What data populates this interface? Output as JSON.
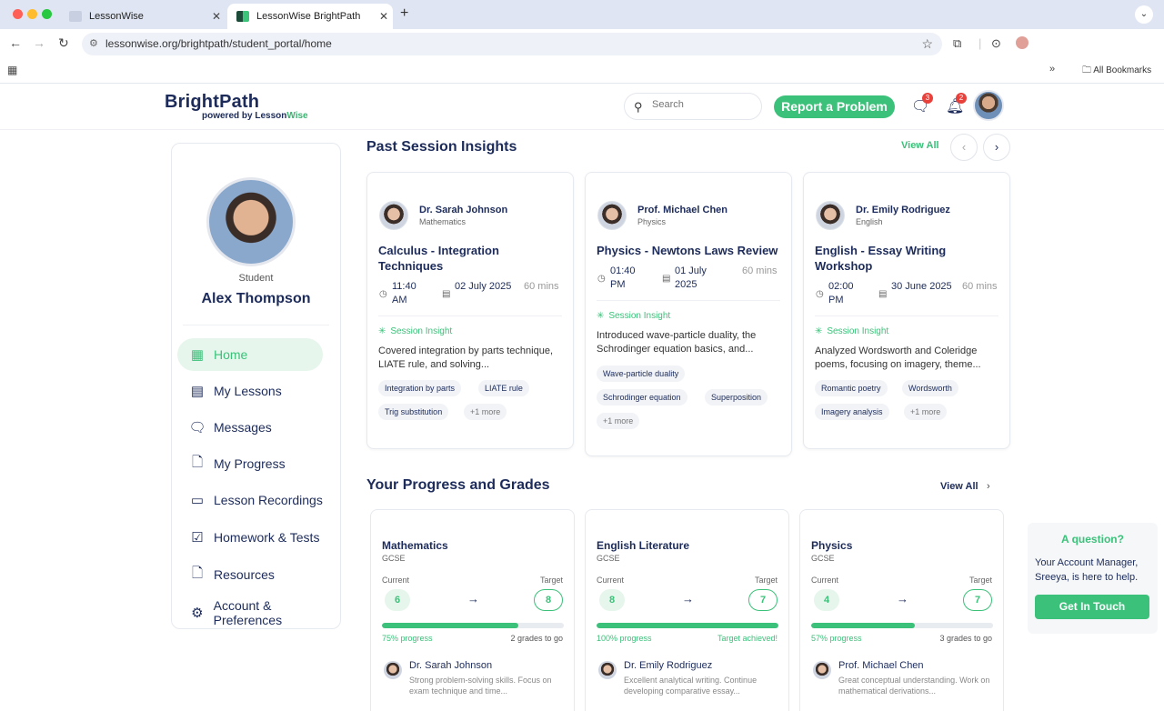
{
  "browser": {
    "tabs": [
      {
        "label": "LessonWise"
      },
      {
        "label": "LessonWise BrightPath"
      }
    ],
    "url": "lessonwise.org/brightpath/student_portal/home",
    "bookmarks_label": "All Bookmarks"
  },
  "header": {
    "logo_main": "BrightPath",
    "logo_sub_prefix": "powered by Lesson",
    "logo_sub_accent": "Wise",
    "search_placeholder": "Search",
    "report_label": "Report a Problem",
    "messages_count": "3",
    "notifications_count": "2"
  },
  "sidebar": {
    "role": "Student",
    "name": "Alex Thompson",
    "items": [
      {
        "label": "Home",
        "icon": "grid-icon"
      },
      {
        "label": "My Lessons",
        "icon": "calendar-icon"
      },
      {
        "label": "Messages",
        "icon": "chat-icon"
      },
      {
        "label": "My Progress",
        "icon": "document-icon"
      },
      {
        "label": "Lesson Recordings",
        "icon": "video-icon"
      },
      {
        "label": "Homework & Tests",
        "icon": "checkbox-icon"
      },
      {
        "label": "Resources",
        "icon": "file-icon"
      },
      {
        "label": "Account & Preferences",
        "icon": "gear-icon"
      }
    ]
  },
  "sessions": {
    "title": "Past Session Insights",
    "view_all": "View All",
    "cards": [
      {
        "tutor": "Dr. Sarah Johnson",
        "subject": "Mathematics",
        "title": "Calculus - Integration Techniques",
        "time": "11:40 AM",
        "date": "02 July 2025",
        "duration": "60 mins",
        "insight_label": "Session Insight",
        "insight": "Covered integration by parts technique, LIATE rule, and solving...",
        "tags": [
          "Integration by parts",
          "LIATE rule",
          "Trig substitution",
          "+1 more"
        ]
      },
      {
        "tutor": "Prof. Michael Chen",
        "subject": "Physics",
        "title": "Physics - Newtons Laws Review",
        "time": "01:40 PM",
        "date": "01 July 2025",
        "duration": "60 mins",
        "insight_label": "Session Insight",
        "insight": "Introduced wave-particle duality, the Schrodinger equation basics, and...",
        "tags": [
          "Wave-particle duality",
          "Schrodinger equation",
          "Superposition",
          "+1 more"
        ]
      },
      {
        "tutor": "Dr. Emily Rodriguez",
        "subject": "English",
        "title": "English - Essay Writing Workshop",
        "time": "02:00 PM",
        "date": "30 June 2025",
        "duration": "60 mins",
        "insight_label": "Session Insight",
        "insight": "Analyzed Wordsworth and Coleridge poems, focusing on imagery, theme...",
        "tags": [
          "Romantic poetry",
          "Wordsworth",
          "Imagery analysis",
          "+1 more"
        ]
      }
    ]
  },
  "progress": {
    "title": "Your Progress and Grades",
    "view_all": "View All",
    "current_label": "Current",
    "target_label": "Target",
    "cards": [
      {
        "subject": "Mathematics",
        "level": "GCSE",
        "current": "6",
        "target": "8",
        "progress_pct": 75,
        "progress_label": "75% progress",
        "status": "2 grades to go",
        "tutor": "Dr. Sarah Johnson",
        "feedback": "Strong problem-solving skills. Focus on exam technique and time..."
      },
      {
        "subject": "English Literature",
        "level": "GCSE",
        "current": "8",
        "target": "7",
        "progress_pct": 100,
        "progress_label": "100% progress",
        "status": "Target achieved!",
        "tutor": "Dr. Emily Rodriguez",
        "feedback": "Excellent analytical writing. Continue developing comparative essay..."
      },
      {
        "subject": "Physics",
        "level": "GCSE",
        "current": "4",
        "target": "7",
        "progress_pct": 57,
        "progress_label": "57% progress",
        "status": "3 grades to go",
        "tutor": "Prof. Michael Chen",
        "feedback": "Great conceptual understanding. Work on mathematical derivations..."
      }
    ]
  },
  "help": {
    "title": "A question?",
    "text": "Your Account Manager, Sreeya, is here to help.",
    "button": "Get In Touch"
  },
  "colors": {
    "accent": "#3cc17a",
    "navy": "#1c2b5a",
    "badge": "#e8413c"
  }
}
